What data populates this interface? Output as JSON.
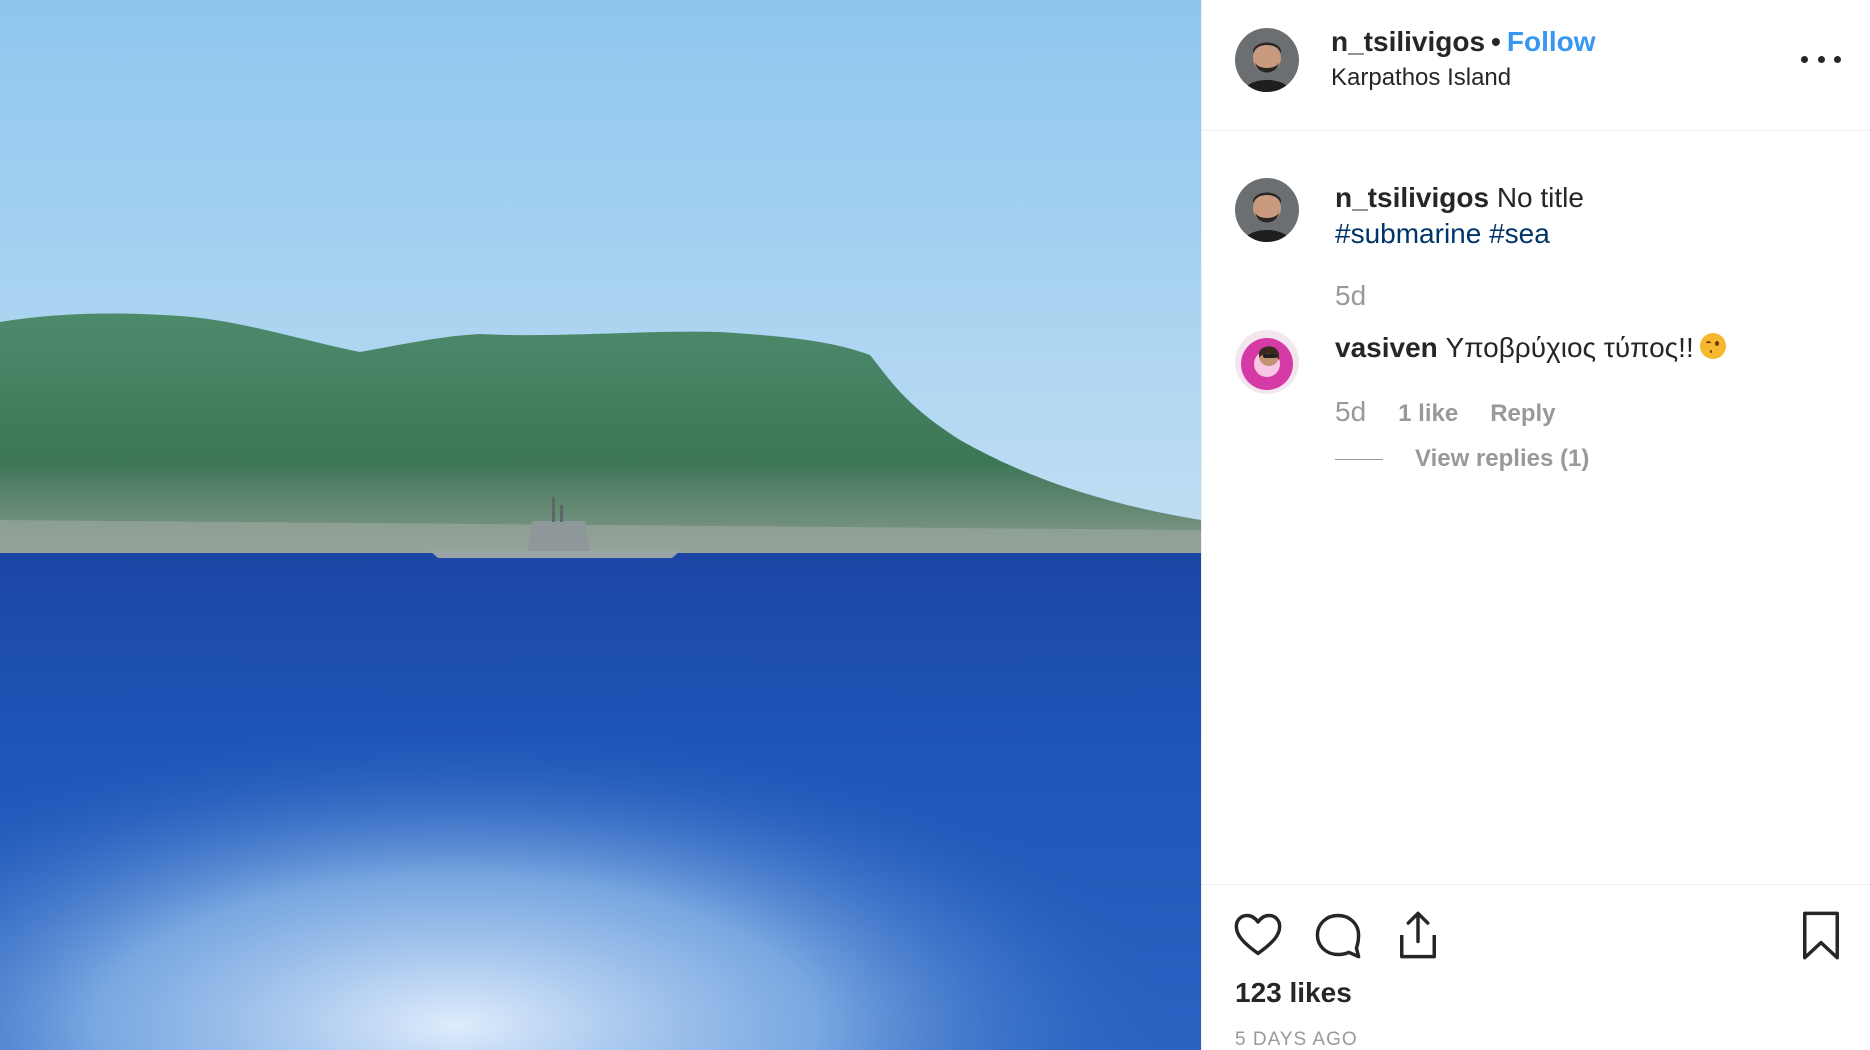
{
  "post": {
    "author": "n_tsilivigos",
    "separator": "•",
    "follow_label": "Follow",
    "location": "Karpathos Island",
    "more_icon": "more-options-icon",
    "image_description_icon": "post-photo",
    "colors": {
      "follow": "#3897f0",
      "hashtag": "#003569",
      "muted": "#999999",
      "text": "#262626"
    }
  },
  "caption": {
    "username": "n_tsilivigos",
    "text": "No title",
    "hashtags": [
      "#submarine",
      "#sea"
    ],
    "time": "5d"
  },
  "comments": [
    {
      "username": "vasiven",
      "text": "Υποβρύχιος τύπος!!",
      "emoji": "winking-face-emoji",
      "time": "5d",
      "likes": "1 like",
      "reply_label": "Reply",
      "view_replies": "View replies (1)"
    }
  ],
  "actions": {
    "like_icon": "heart-icon",
    "comment_icon": "comment-bubble-icon",
    "share_icon": "share-icon",
    "save_icon": "bookmark-icon"
  },
  "likes": "123 likes",
  "date": "5 DAYS AGO"
}
